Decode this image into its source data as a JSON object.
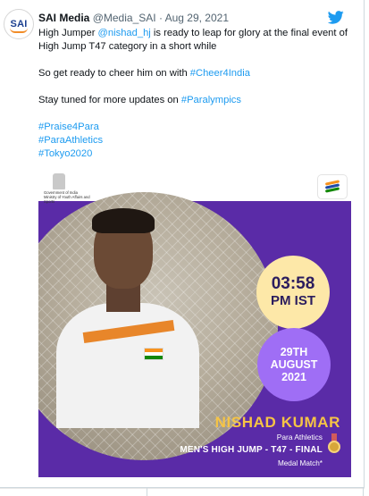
{
  "tweet": {
    "avatar_text": "SAI",
    "display_name": "SAI Media",
    "handle": "@Media_SAI",
    "separator": "·",
    "date": "Aug 29, 2021",
    "line1_pre": "High Jumper ",
    "line1_mention": "@nishad_hj",
    "line1_post": " is ready to leap for glory at the final event of",
    "line2": "High Jump T47 category in a short while",
    "line3_pre": "So get ready to cheer him on with ",
    "line3_hashtag": "#Cheer4India",
    "line4_pre": "Stay tuned for more updates on ",
    "line4_hashtag": "#Paralympics",
    "hashtags": [
      "#Praise4Para",
      "#ParaAthletics",
      "#Tokyo2020"
    ]
  },
  "media": {
    "ministry_line1": "Government of India",
    "ministry_line2": "Ministry of Youth Affairs and Sports",
    "time_main": "03:58",
    "time_sub": "PM IST",
    "date_line1": "29TH",
    "date_line2": "AUGUST",
    "date_line3": "2021",
    "athlete_name": "NISHAD KUMAR",
    "sport": "Para Athletics",
    "event": "MEN'S HIGH JUMP - T47 - FINAL",
    "note": "Medal Match*"
  },
  "icons": {
    "platform": "twitter-bird-icon",
    "emblem": "national-emblem-icon",
    "corner_logo": "paralympics-logo-icon",
    "medal": "medal-icon"
  },
  "colors": {
    "link": "#1d9bf0",
    "media_bg": "#5a2ba7",
    "time_badge": "#fde8a8",
    "date_badge": "#9f6ef5",
    "name_gold": "#f6c445"
  }
}
